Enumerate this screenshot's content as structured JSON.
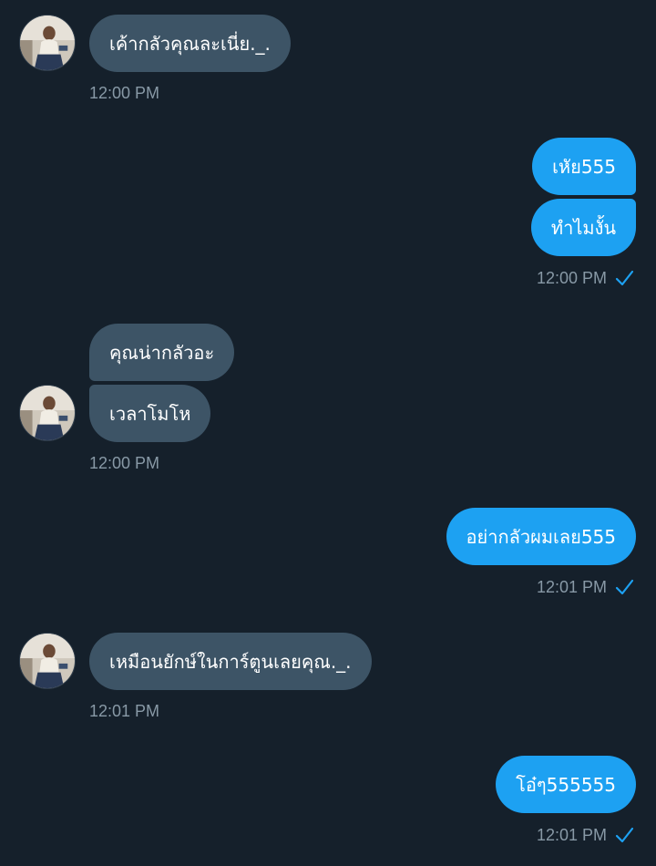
{
  "conversation": {
    "messages": [
      {
        "direction": "in",
        "text": "เค้ากลัวคุณละเนี่ย._."
      },
      {
        "direction": "out",
        "text": "เหัย555"
      },
      {
        "direction": "out",
        "text": "ทำไมงั้น"
      },
      {
        "direction": "in",
        "text": "คุณน่ากลัวอะ"
      },
      {
        "direction": "in",
        "text": "เวลาโมโห"
      },
      {
        "direction": "out",
        "text": "อย่ากลัวผมเลย555"
      },
      {
        "direction": "in",
        "text": "เหมือนยักษ์ในการ์ตูนเลยคุณ._."
      },
      {
        "direction": "out",
        "text": "โอ๋ๆ555555"
      }
    ],
    "timestamps": [
      "12:00 PM",
      "12:00 PM",
      "12:00 PM",
      "12:01 PM",
      "12:01 PM",
      "12:01 PM"
    ]
  },
  "colors": {
    "background": "#15202b",
    "incoming_bubble": "#3d5466",
    "outgoing_bubble": "#1da1f2",
    "timestamp": "#8899a6",
    "check": "#1da1f2"
  },
  "icons": {
    "avatar": "user-avatar-photo",
    "read_receipt": "check-icon"
  }
}
